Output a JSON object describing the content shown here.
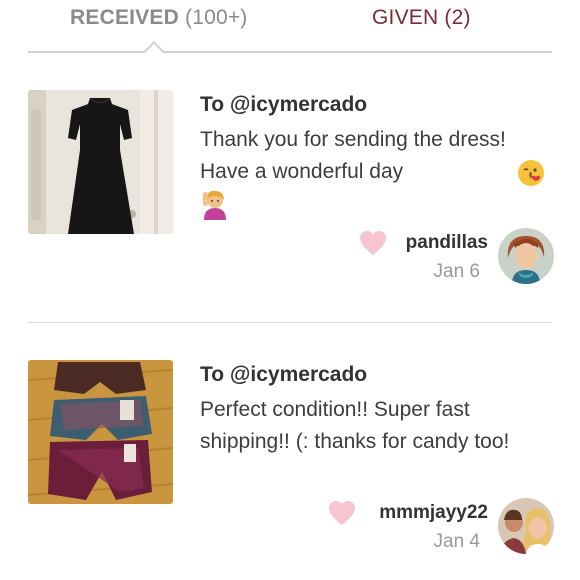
{
  "tabs": {
    "received_label": "RECEIVED",
    "received_count": "(100+)",
    "given_label": "GIVEN (2)",
    "active": "received"
  },
  "reviews": [
    {
      "recipient": "To @icymercado",
      "message": "Thank you for sending the dress! Have a wonderful day",
      "reviewer": "pandillas",
      "date": "Jan 6",
      "photo_icon": "black-dress-photo",
      "emojis": [
        "face-blowing-kiss-emoji",
        "person-raising-hand-emoji"
      ]
    },
    {
      "recipient": "To @icymercado",
      "message": "Perfect condition!! Super fast shipping!! (: thanks for candy too!",
      "reviewer": "mmmjayy22",
      "date": "Jan 4",
      "photo_icon": "shorts-photo"
    }
  ],
  "colors": {
    "given_tab": "#7a2a3a",
    "heart": "#f7c5d2",
    "divider": "#cfcfcf"
  }
}
